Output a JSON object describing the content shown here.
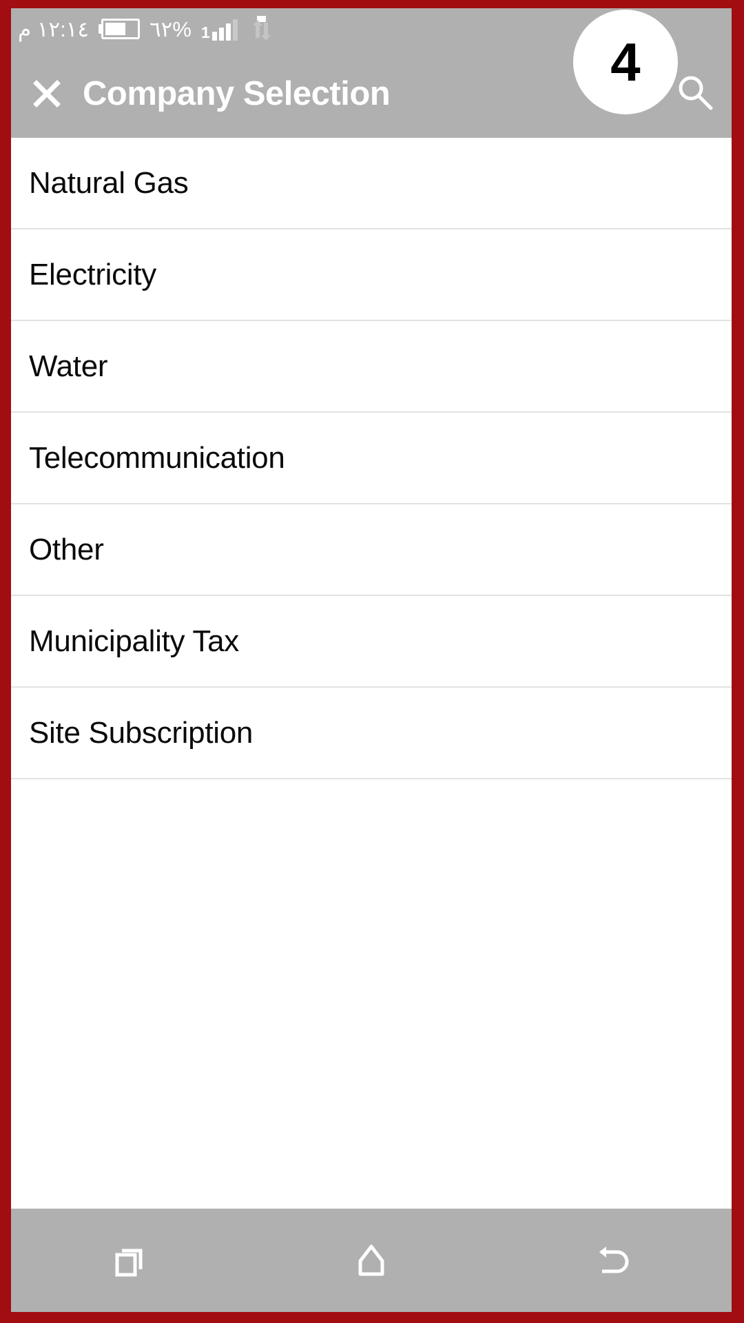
{
  "status_bar": {
    "time": "١٢:١٤ م",
    "battery_percent": "%٦٢",
    "signal_number": "1",
    "icons": [
      "battery-icon",
      "signal-bars-icon",
      "data-transfer-icon"
    ]
  },
  "app_bar": {
    "title": "Company Selection",
    "close_icon": "close-icon",
    "search_icon": "search-icon",
    "badge_count": "4"
  },
  "list": {
    "items": [
      {
        "label": "Natural Gas"
      },
      {
        "label": "Electricity"
      },
      {
        "label": "Water"
      },
      {
        "label": "Telecommunication"
      },
      {
        "label": "Other"
      },
      {
        "label": "Municipality Tax"
      },
      {
        "label": "Site Subscription"
      }
    ]
  },
  "nav_bar": {
    "buttons": [
      {
        "name": "recents",
        "icon": "recents-icon"
      },
      {
        "name": "home",
        "icon": "home-icon"
      },
      {
        "name": "back",
        "icon": "back-icon"
      }
    ]
  },
  "colors": {
    "bezel_red": "#a20d12",
    "bar_gray": "#b0b0b0",
    "surface_white": "#ffffff",
    "divider": "#e2e2e2",
    "text_dark": "#0a0a0a"
  }
}
